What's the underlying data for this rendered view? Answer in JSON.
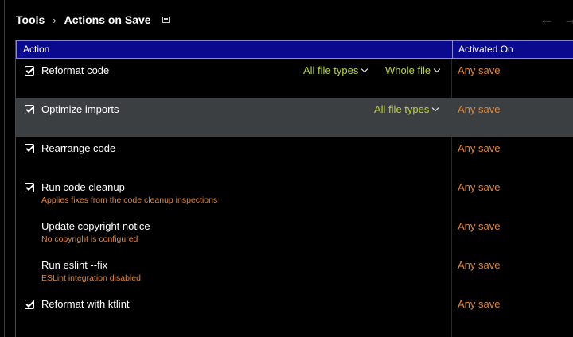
{
  "breadcrumb": {
    "parent": "Tools",
    "separator": "›",
    "current": "Actions on Save"
  },
  "nav": {
    "back": "←",
    "forward": "→"
  },
  "table": {
    "headers": {
      "action": "Action",
      "activated_on": "Activated On"
    },
    "rows": [
      {
        "title": "Reformat code",
        "checked": true,
        "subtitle": "",
        "opt1": "All file types",
        "opt2": "Whole file",
        "activated": "Any save",
        "selected": false
      },
      {
        "title": "Optimize imports",
        "checked": true,
        "subtitle": "",
        "opt1": "All file types",
        "opt2": "",
        "activated": "Any save",
        "selected": true
      },
      {
        "title": "Rearrange code",
        "checked": true,
        "subtitle": "",
        "opt1": "",
        "opt2": "",
        "activated": "Any save",
        "selected": false
      },
      {
        "title": "Run code cleanup",
        "checked": true,
        "subtitle": "Applies fixes from the code cleanup inspections",
        "opt1": "",
        "opt2": "",
        "activated": "Any save",
        "selected": false
      },
      {
        "title": "Update copyright notice",
        "checked": false,
        "subtitle": "No copyright is configured",
        "opt1": "",
        "opt2": "",
        "activated": "Any save",
        "selected": false
      },
      {
        "title": "Run eslint --fix",
        "checked": false,
        "subtitle": "ESLint integration disabled",
        "opt1": "",
        "opt2": "",
        "activated": "Any save",
        "selected": false
      },
      {
        "title": "Reformat with ktlint",
        "checked": true,
        "subtitle": "",
        "opt1": "",
        "opt2": "",
        "activated": "Any save",
        "selected": false
      }
    ]
  },
  "colors": {
    "header_bg": "#0a0a8f",
    "option": "#b9d23a",
    "activated": "#e0883a",
    "selected_row": "#3c3f41"
  }
}
